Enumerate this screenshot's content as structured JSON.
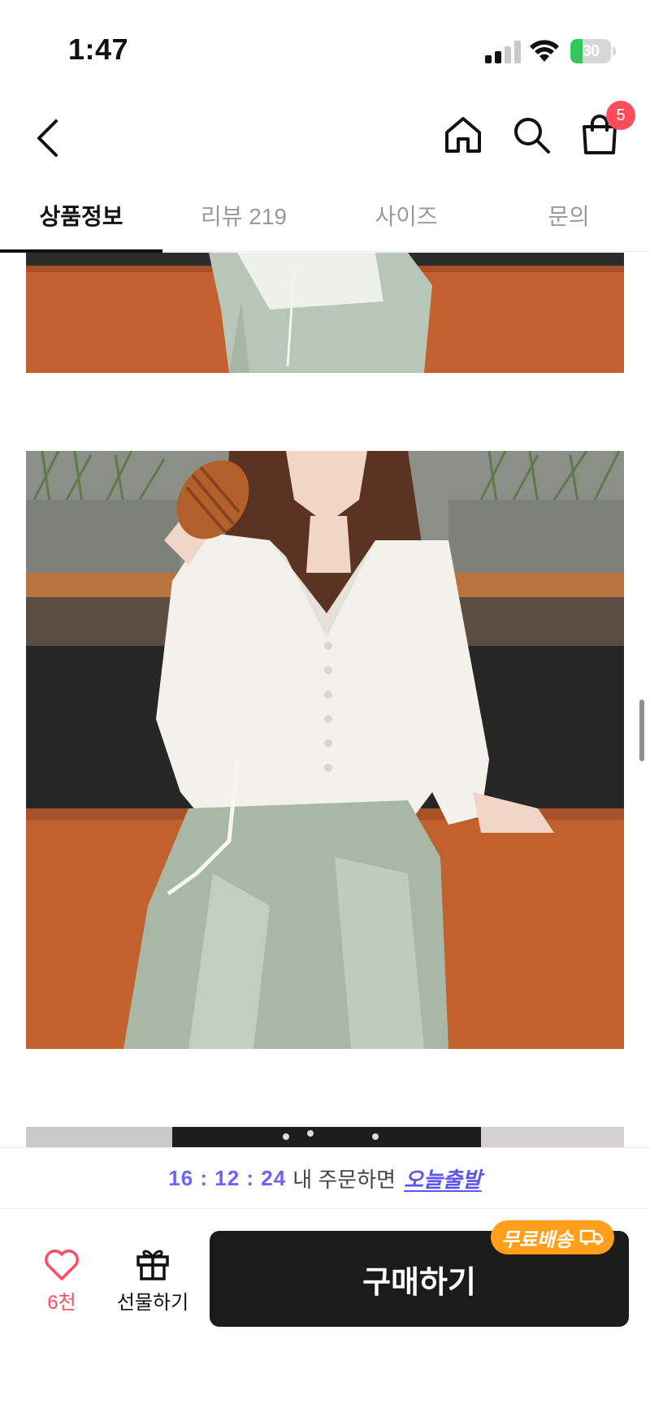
{
  "status_bar": {
    "time": "1:47",
    "battery_level": "30",
    "signal_bars_active": 2,
    "signal_bars_total": 4
  },
  "header": {
    "cart_count": "5",
    "icons": [
      "back-chevron-icon",
      "home-icon",
      "search-icon",
      "shopping-bag-icon"
    ]
  },
  "tabs": [
    {
      "label": "상품정보",
      "active": true
    },
    {
      "label": "리뷰 219",
      "active": false
    },
    {
      "label": "사이즈",
      "active": false
    },
    {
      "label": "문의",
      "active": false
    }
  ],
  "promo": {
    "timer": "16 : 12 : 24",
    "mid_text": "내 주문하면",
    "shipping_text": "오늘출발"
  },
  "bottom_bar": {
    "like_count": "6천",
    "gift_label": "선물하기",
    "buy_label": "구매하기",
    "free_shipping_label": "무료배송"
  },
  "colors": {
    "accent_purple": "#6c63ff",
    "like_red": "#ff4d5e",
    "buy_black": "#1b1b1b",
    "free_orange": "#ff9f1a",
    "battery_green": "#34c759"
  }
}
